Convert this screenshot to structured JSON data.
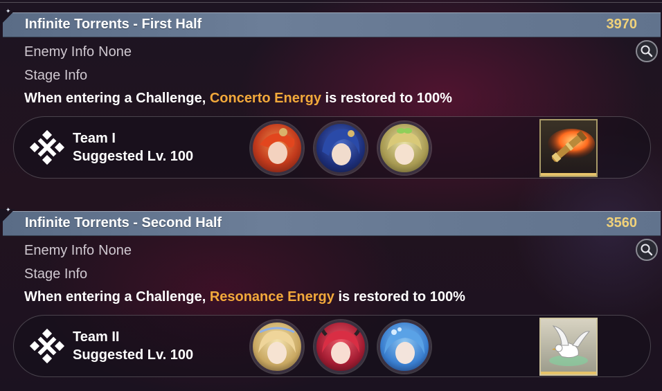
{
  "sections": [
    {
      "title": "Infinite Torrents - First Half",
      "score": "3970",
      "enemy_label": "Enemy Info",
      "enemy_value": "None",
      "stage_label": "Stage Info",
      "desc_pre": "When entering a Challenge, ",
      "desc_highlight": "Concerto Energy",
      "desc_post": " is restored to 100%",
      "team_name": "Team I",
      "team_level": "Suggested Lv. 100",
      "item_icon": "spyglass-icon"
    },
    {
      "title": "Infinite Torrents - Second Half",
      "score": "3560",
      "enemy_label": "Enemy Info",
      "enemy_value": "None",
      "stage_label": "Stage Info",
      "desc_pre": "When entering a Challenge, ",
      "desc_highlight": "Resonance Energy",
      "desc_post": " is restored to 100%",
      "team_name": "Team II",
      "team_level": "Suggested Lv. 100",
      "item_icon": "dove-icon"
    }
  ],
  "colors": {
    "header_bg": "#6c7e98",
    "score": "#f1d27a",
    "highlight": "#f2a93b",
    "muted_text": "#cfc8d0"
  }
}
